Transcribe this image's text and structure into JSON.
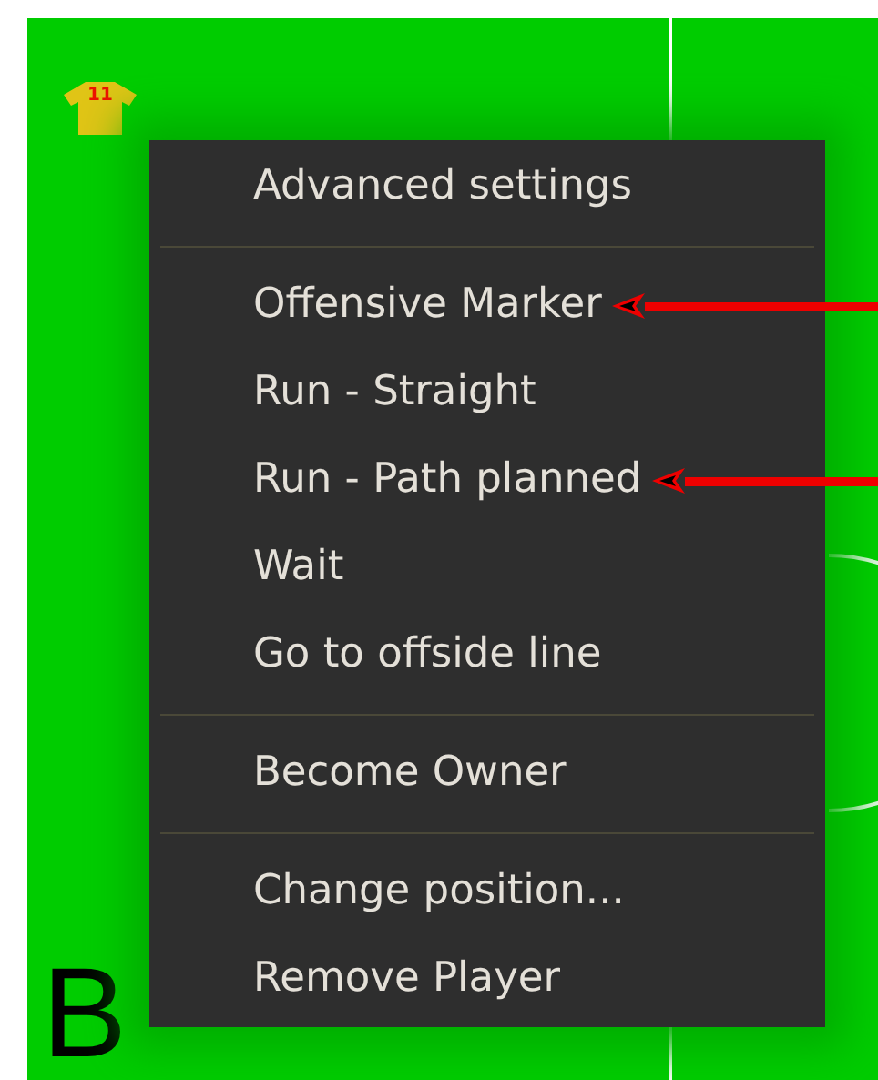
{
  "player": {
    "number": "11"
  },
  "menu": {
    "sections": [
      {
        "items": [
          {
            "label": "Advanced settings",
            "marked": false
          }
        ]
      },
      {
        "items": [
          {
            "label": "Offensive Marker",
            "marked": true
          },
          {
            "label": "Run - Straight",
            "marked": false
          },
          {
            "label": "Run - Path planned",
            "marked": true
          },
          {
            "label": "Wait",
            "marked": false
          },
          {
            "label": "Go to offside line",
            "marked": false
          }
        ]
      },
      {
        "items": [
          {
            "label": "Become Owner",
            "marked": false
          }
        ]
      },
      {
        "items": [
          {
            "label": "Change position...",
            "marked": false
          },
          {
            "label": "Remove Player",
            "marked": false
          }
        ]
      }
    ]
  },
  "panel_label": "B"
}
